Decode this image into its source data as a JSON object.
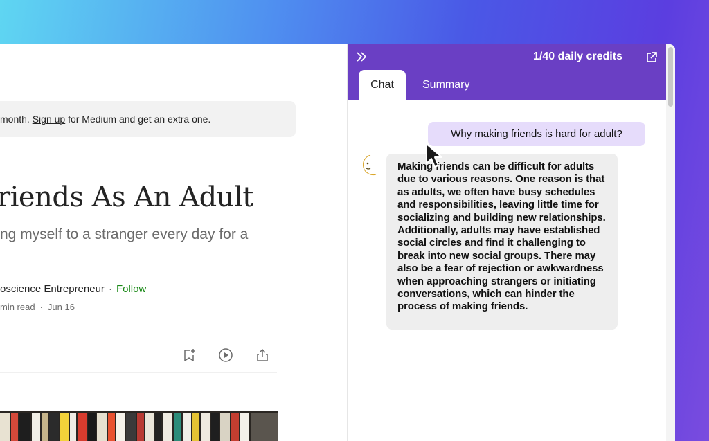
{
  "article": {
    "banner_prefix": "month. ",
    "banner_link": "Sign up",
    "banner_suffix": " for Medium and get an extra one.",
    "title": "riends As An Adult",
    "subtitle": "ng myself to a stranger every day for a",
    "author": "oscience Entrepreneur",
    "follow": "Follow",
    "read_time": "min read",
    "date": "Jun 16",
    "actions": [
      "bookmark-add-icon",
      "play-icon",
      "share-icon"
    ]
  },
  "panel": {
    "credits": "1/40 daily credits",
    "tabs": [
      {
        "label": "Chat",
        "active": true
      },
      {
        "label": "Summary",
        "active": false
      }
    ],
    "accent": "#6a3fc4",
    "messages": [
      {
        "role": "user",
        "text": "Why making friends is hard for adult?"
      },
      {
        "role": "assistant",
        "text": "Making friends can be difficult for adults due to various reasons. One reason is that as adults, we often have busy schedules and responsibilities, leaving little time for socializing and building new relationships. Additionally, adults may have established social circles and find it challenging to break into new social groups. There may also be a fear of rejection or awkwardness when approaching strangers or initiating conversations, which can hinder the process of making friends."
      }
    ]
  }
}
